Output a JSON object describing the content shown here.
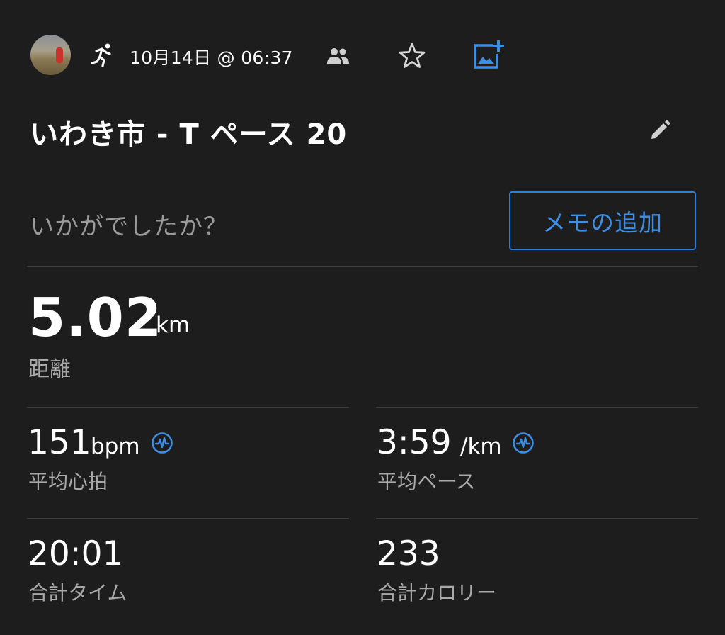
{
  "header": {
    "date": "10月14日 @ 06:37",
    "icons": [
      "avatar",
      "running-icon",
      "people-icon",
      "star-icon",
      "add-photo-icon"
    ]
  },
  "activity": {
    "title": "いわき市 - T ペース 20",
    "prompt": "いかがでしたか？",
    "memo_button": "メモの追加"
  },
  "distance": {
    "value": "5.02",
    "unit": "km",
    "label": "距離"
  },
  "stats": [
    {
      "value": "151",
      "unit": "bpm",
      "label": "平均心拍",
      "icon": "heart-rate-icon"
    },
    {
      "value": "3:59",
      "unit": "/km",
      "label": "平均ペース",
      "icon": "heart-rate-icon"
    },
    {
      "value": "20:01",
      "unit": "",
      "label": "合計タイム"
    },
    {
      "value": "233",
      "unit": "",
      "label": "合計カロリー"
    }
  ],
  "colors": {
    "background": "#1d1d1e",
    "accent_blue": "#3d8ee6",
    "label_gray": "#a8a8a8",
    "divider": "#3f3f40"
  }
}
